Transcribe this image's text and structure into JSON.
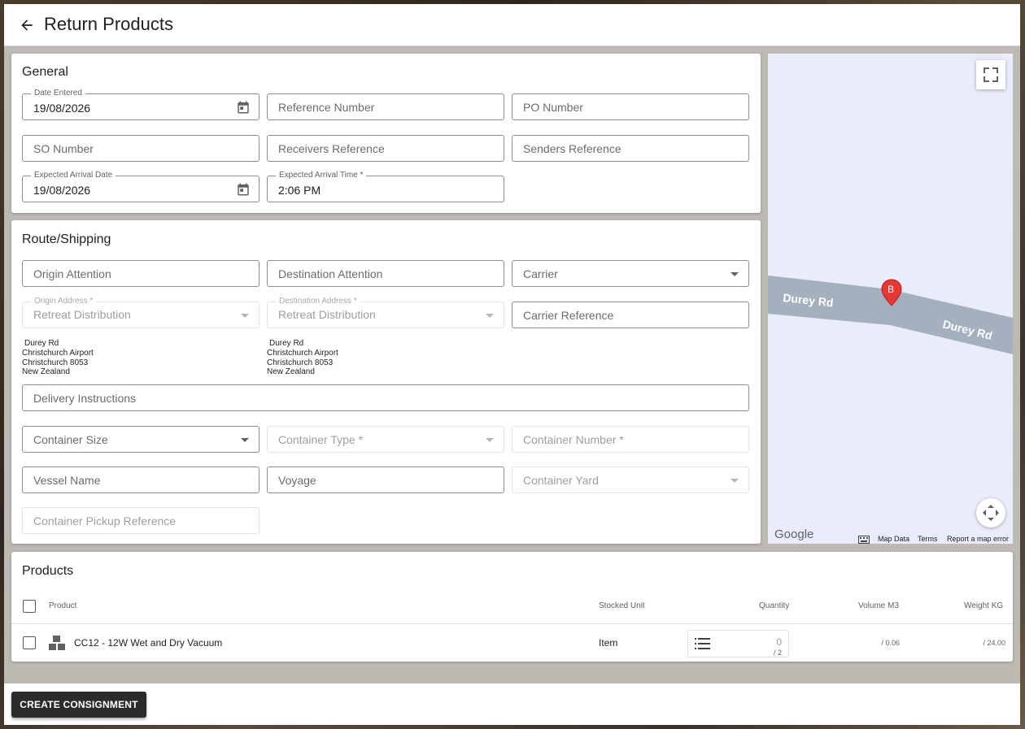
{
  "header": {
    "title": "Return Products"
  },
  "general": {
    "title": "General",
    "date_entered": {
      "label": "Date Entered",
      "value": "19/08/2026"
    },
    "reference_number": {
      "placeholder": "Reference Number"
    },
    "po_number": {
      "placeholder": "PO Number"
    },
    "so_number": {
      "placeholder": "SO Number"
    },
    "receivers_reference": {
      "placeholder": "Receivers Reference"
    },
    "senders_reference": {
      "placeholder": "Senders Reference"
    },
    "expected_arrival_date": {
      "label": "Expected Arrival Date",
      "value": "19/08/2026"
    },
    "expected_arrival_time": {
      "label": "Expected Arrival Time *",
      "value": "2:06 PM"
    }
  },
  "route": {
    "title": "Route/Shipping",
    "origin_attention": {
      "placeholder": "Origin Attention"
    },
    "destination_attention": {
      "placeholder": "Destination Attention"
    },
    "carrier": {
      "placeholder": "Carrier"
    },
    "origin_address": {
      "label": "Origin Address *",
      "value": "Retreat Distribution"
    },
    "destination_address": {
      "label": "Destination Address *",
      "value": "Retreat Distribution"
    },
    "carrier_reference": {
      "placeholder": "Carrier Reference"
    },
    "origin_address_lines": [
      "Durey Rd",
      "Christchurch Airport",
      "Christchurch 8053",
      "New Zealand"
    ],
    "destination_address_lines": [
      "Durey Rd",
      "Christchurch Airport",
      "Christchurch 8053",
      "New Zealand"
    ],
    "delivery_instructions": {
      "placeholder": "Delivery Instructions"
    },
    "container_size": {
      "placeholder": "Container Size"
    },
    "container_type": {
      "placeholder": "Container Type *"
    },
    "container_number": {
      "placeholder": "Container Number *"
    },
    "vessel_name": {
      "placeholder": "Vessel Name"
    },
    "voyage": {
      "placeholder": "Voyage"
    },
    "container_yard": {
      "placeholder": "Container Yard"
    },
    "container_pickup_reference": {
      "placeholder": "Container Pickup Reference"
    }
  },
  "map": {
    "road_label": "Durey Rd",
    "marker_label": "B",
    "google_logo": "Google",
    "map_data": "Map Data",
    "terms": "Terms",
    "report": "Report a map error"
  },
  "products": {
    "title": "Products",
    "columns": {
      "product": "Product",
      "stocked_unit": "Stocked Unit",
      "quantity": "Quantity",
      "volume": "Volume M3",
      "weight": "Weight KG"
    },
    "rows": [
      {
        "name": "CC12 - 12W Wet and Dry Vacuum",
        "unit": "Item",
        "quantity": "0",
        "quantity_max": "/ 2",
        "volume": "/ 0.06",
        "weight": "/ 24.00"
      }
    ]
  },
  "footer": {
    "create_label": "CREATE CONSIGNMENT"
  },
  "colors": {
    "map_bg": "#e8ecfb",
    "road": "#a4b0bd",
    "marker": "#e53935",
    "button": "#2b2b2b"
  }
}
